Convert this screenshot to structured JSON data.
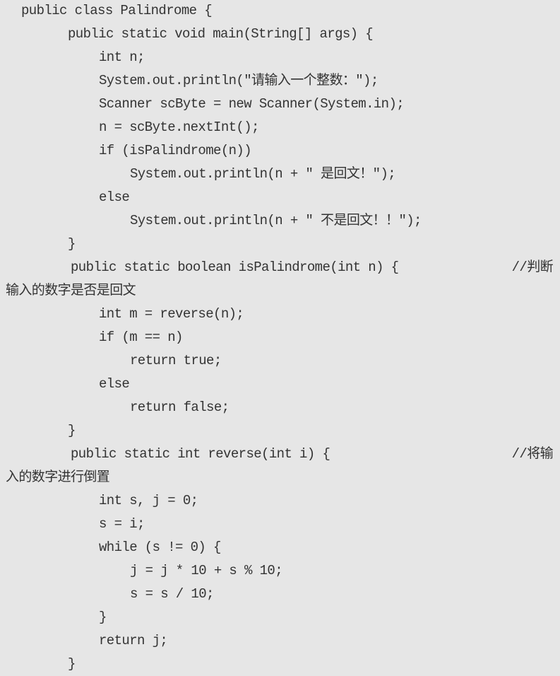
{
  "document": {
    "language": "java",
    "lines": [
      {
        "indent": 30,
        "text": "public class Palindrome {"
      },
      {
        "indent": 96,
        "text": "public static void main(String[] args) {"
      },
      {
        "indent": 140,
        "text": "int n;"
      },
      {
        "indent": 140,
        "text": "System.out.println(\"请输入一个整数：\");"
      },
      {
        "indent": 140,
        "text": "Scanner scByte = new Scanner(System.in);"
      },
      {
        "indent": 140,
        "text": "n = scByte.nextInt();"
      },
      {
        "indent": 140,
        "text": "if (isPalindrome(n))"
      },
      {
        "indent": 184,
        "text": "System.out.println(n + \" 是回文！\");"
      },
      {
        "indent": 140,
        "text": "else"
      },
      {
        "indent": 184,
        "text": "System.out.println(n + \" 不是回文！！\");"
      },
      {
        "indent": 96,
        "text": "}"
      },
      {
        "indent": 100,
        "text": "public static boolean isPalindrome(int n) {",
        "comment": "//判断"
      },
      {
        "indent": 8,
        "text": "输入的数字是否是回文"
      },
      {
        "indent": 140,
        "text": "int m = reverse(n);"
      },
      {
        "indent": 140,
        "text": "if (m == n)"
      },
      {
        "indent": 184,
        "text": "return true;"
      },
      {
        "indent": 140,
        "text": "else"
      },
      {
        "indent": 184,
        "text": "return false;"
      },
      {
        "indent": 96,
        "text": "}"
      },
      {
        "indent": 100,
        "text": "public static int reverse(int i) {",
        "comment": "//将输"
      },
      {
        "indent": 8,
        "text": "入的数字进行倒置"
      },
      {
        "indent": 140,
        "text": "int s, j = 0;"
      },
      {
        "indent": 140,
        "text": "s = i;"
      },
      {
        "indent": 140,
        "text": "while (s != 0) {"
      },
      {
        "indent": 184,
        "text": "j = j * 10 + s % 10;"
      },
      {
        "indent": 184,
        "text": "s = s / 10;"
      },
      {
        "indent": 140,
        "text": "}"
      },
      {
        "indent": 140,
        "text": "return j;"
      },
      {
        "indent": 96,
        "text": "}"
      }
    ]
  },
  "colors": {
    "background": "#e6e6e6",
    "text": "#333333"
  }
}
